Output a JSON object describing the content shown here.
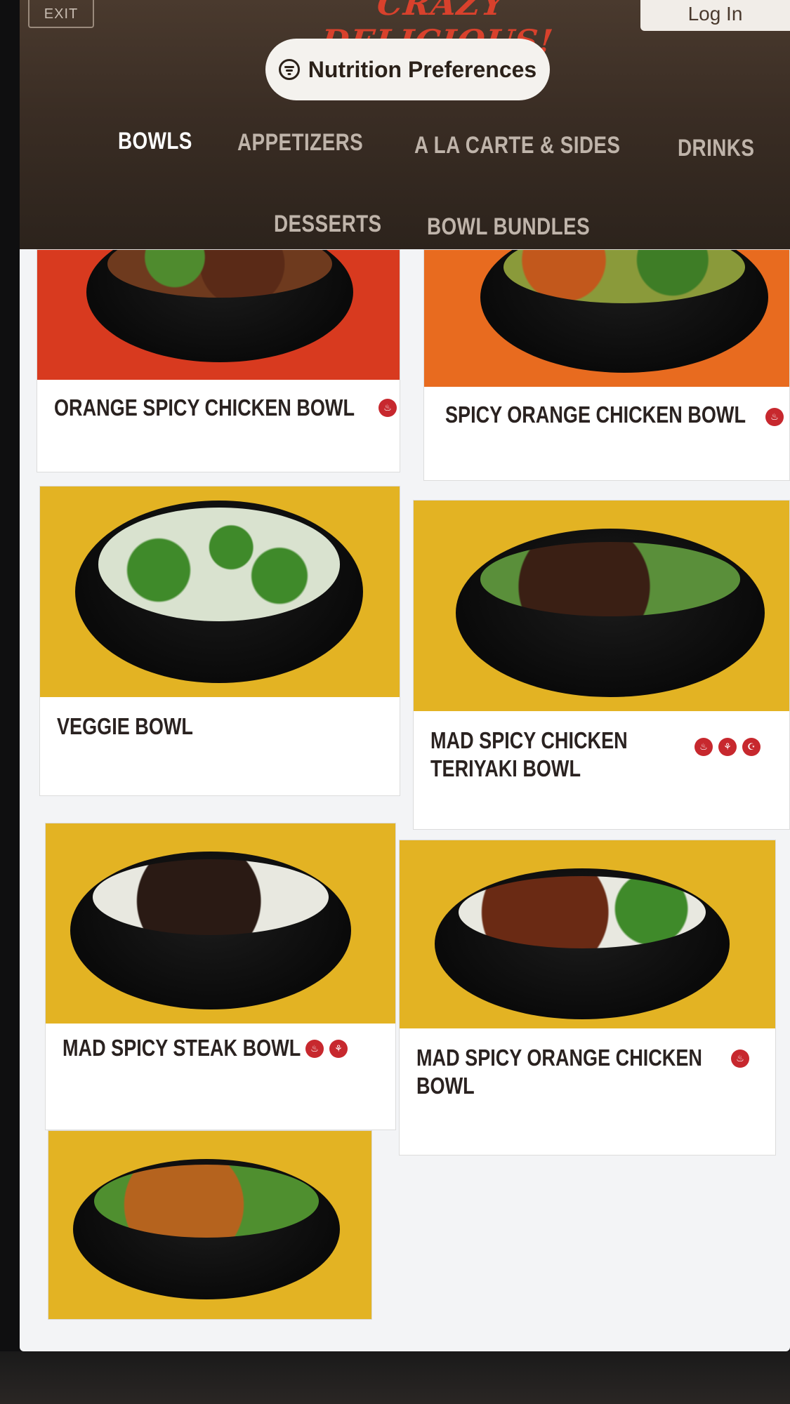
{
  "header": {
    "exit_label": "EXIT",
    "brand_text": "CRAZY DELICIOUS!",
    "login_label": "Log In",
    "nutrition_label": "Nutrition Preferences"
  },
  "tabs": [
    "BOWLS",
    "APPETIZERS",
    "A LA CARTE & SIDES",
    "DRINKS",
    "DESSERTS",
    "BOWL BUNDLES"
  ],
  "active_tab": "BOWLS",
  "menu_items": [
    {
      "name": "ORANGE SPICY CHICKEN BOWL",
      "badges": [
        "spicy"
      ],
      "bg": "#d83a1f"
    },
    {
      "name": "SPICY ORANGE CHICKEN BOWL",
      "badges": [
        "spicy"
      ],
      "bg": "#e86b1f"
    },
    {
      "name": "VEGGIE BOWL",
      "badges": [],
      "bg": "#e3b323"
    },
    {
      "name_line1": "MAD SPICY CHICKEN",
      "name_line2": "TERIYAKI BOWL",
      "badges": [
        "spicy",
        "wheat",
        "halal"
      ],
      "bg": "#e3b323"
    },
    {
      "name": "MAD SPICY STEAK BOWL",
      "badges": [
        "spicy",
        "wheat"
      ],
      "bg": "#e3b323"
    },
    {
      "name_line1": "MAD SPICY ORANGE CHICKEN",
      "name_line2": "BOWL",
      "badges": [
        "spicy"
      ],
      "bg": "#e3b323"
    },
    {
      "name": "",
      "badges": [],
      "bg": "#e3b323"
    }
  ],
  "colors": {
    "accent_red": "#c7282e",
    "header_brown": "#3a2d24",
    "yellow_bg": "#e3b323"
  }
}
